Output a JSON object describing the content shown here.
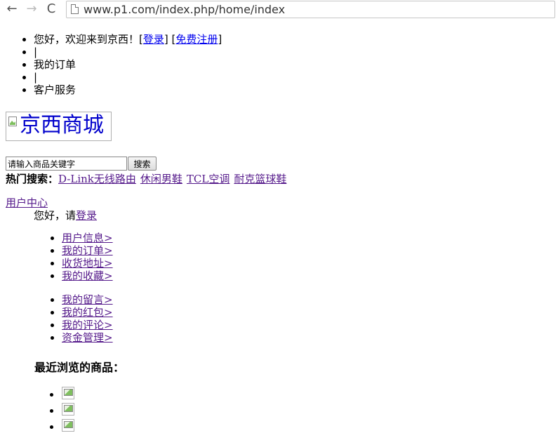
{
  "browser": {
    "url": "www.p1.com/index.php/home/index",
    "back_glyph": "←",
    "forward_glyph": "→",
    "reload_glyph": "C"
  },
  "topbar": {
    "greeting": "您好，欢迎来到京西！[",
    "login": "登录",
    "between": "] [",
    "register": "免费注册",
    "end": "]",
    "sep1": "|",
    "orders": "我的订单",
    "sep2": "|",
    "service": "客户服务"
  },
  "logo": {
    "alt": "京西商城"
  },
  "search": {
    "value": "请输入商品关键字",
    "button": "搜索",
    "hot_label": "热门搜索：",
    "hot": [
      "D-Link无线路由",
      "休闲男鞋",
      "TCL空调",
      "耐克篮球鞋"
    ]
  },
  "user_center": {
    "title": "用户中心",
    "greet": "您好，请",
    "login": "登录",
    "menu1": [
      "用户信息>",
      "我的订单>",
      "收货地址>",
      "我的收藏>"
    ],
    "menu2": [
      "我的留言>",
      "我的红包>",
      "我的评论>",
      "资金管理>"
    ]
  },
  "recent": {
    "title": "最近浏览的商品："
  }
}
